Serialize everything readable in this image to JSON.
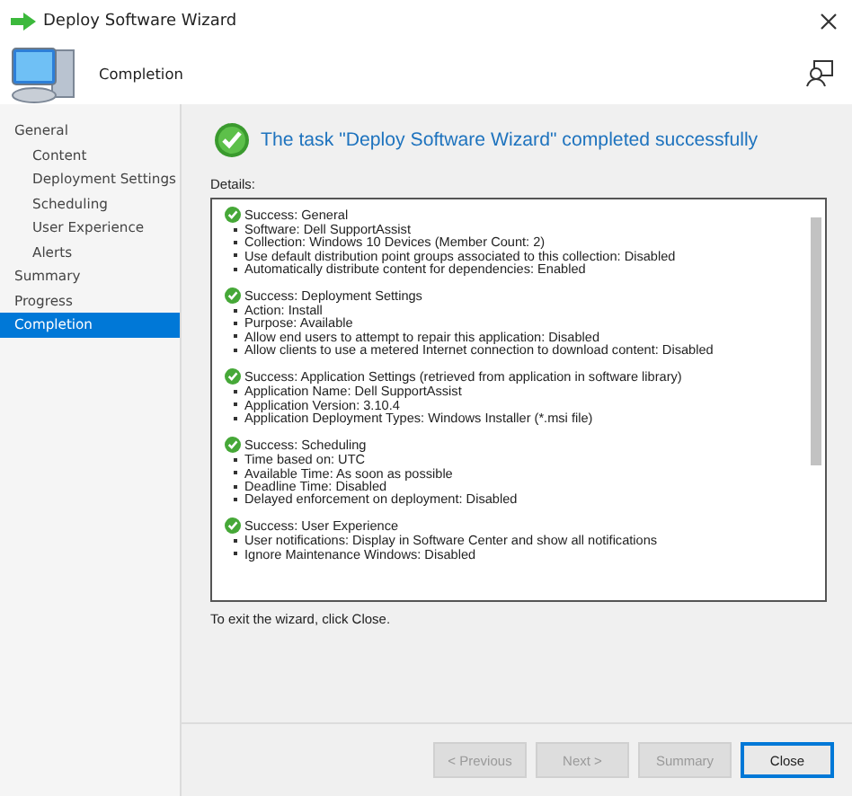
{
  "window": {
    "title": "Deploy Software Wizard"
  },
  "header": {
    "title": "Completion"
  },
  "nav": [
    {
      "label": "General",
      "selected": false,
      "children": [
        {
          "label": "Content",
          "selected": false
        },
        {
          "label": "Deployment Settings",
          "selected": false
        },
        {
          "label": "Scheduling",
          "selected": false
        },
        {
          "label": "User Experience",
          "selected": false
        },
        {
          "label": "Alerts",
          "selected": false
        }
      ]
    },
    {
      "label": "Summary",
      "selected": false
    },
    {
      "label": "Progress",
      "selected": false
    },
    {
      "label": "Completion",
      "selected": true
    }
  ],
  "result": {
    "message": "The task \"Deploy Software Wizard\" completed successfully"
  },
  "details": {
    "label": "Details:",
    "sections": [
      {
        "title": "Success: General",
        "items": [
          "Software: Dell SupportAssist",
          "Collection: Windows 10 Devices (Member Count: 2)",
          "Use default distribution point groups associated to this collection: Disabled",
          "Automatically distribute content for dependencies: Enabled"
        ]
      },
      {
        "title": "Success: Deployment Settings",
        "items": [
          "Action: Install",
          "Purpose: Available",
          "Allow end users to attempt to repair this application: Disabled",
          "Allow clients to use a metered Internet connection to download content: Disabled"
        ]
      },
      {
        "title": "Success: Application Settings (retrieved from application in software library)",
        "items": [
          "Application Name: Dell SupportAssist",
          "Application Version: 3.10.4",
          "Application Deployment Types: Windows Installer (*.msi file)"
        ]
      },
      {
        "title": "Success: Scheduling",
        "items": [
          "Time based on: UTC",
          "Available Time: As soon as possible",
          "Deadline Time: Disabled",
          "Delayed enforcement on deployment: Disabled"
        ]
      },
      {
        "title": "Success: User Experience",
        "items": [
          "User notifications: Display in Software Center and show all notifications",
          "Ignore Maintenance Windows: Disabled"
        ]
      }
    ]
  },
  "hint": "To exit the wizard, click Close.",
  "buttons": [
    {
      "label": "< Previous",
      "disabled": true
    },
    {
      "label": "Next >",
      "disabled": true
    },
    {
      "label": "Summary",
      "disabled": true
    },
    {
      "label": "Close",
      "disabled": false
    }
  ]
}
